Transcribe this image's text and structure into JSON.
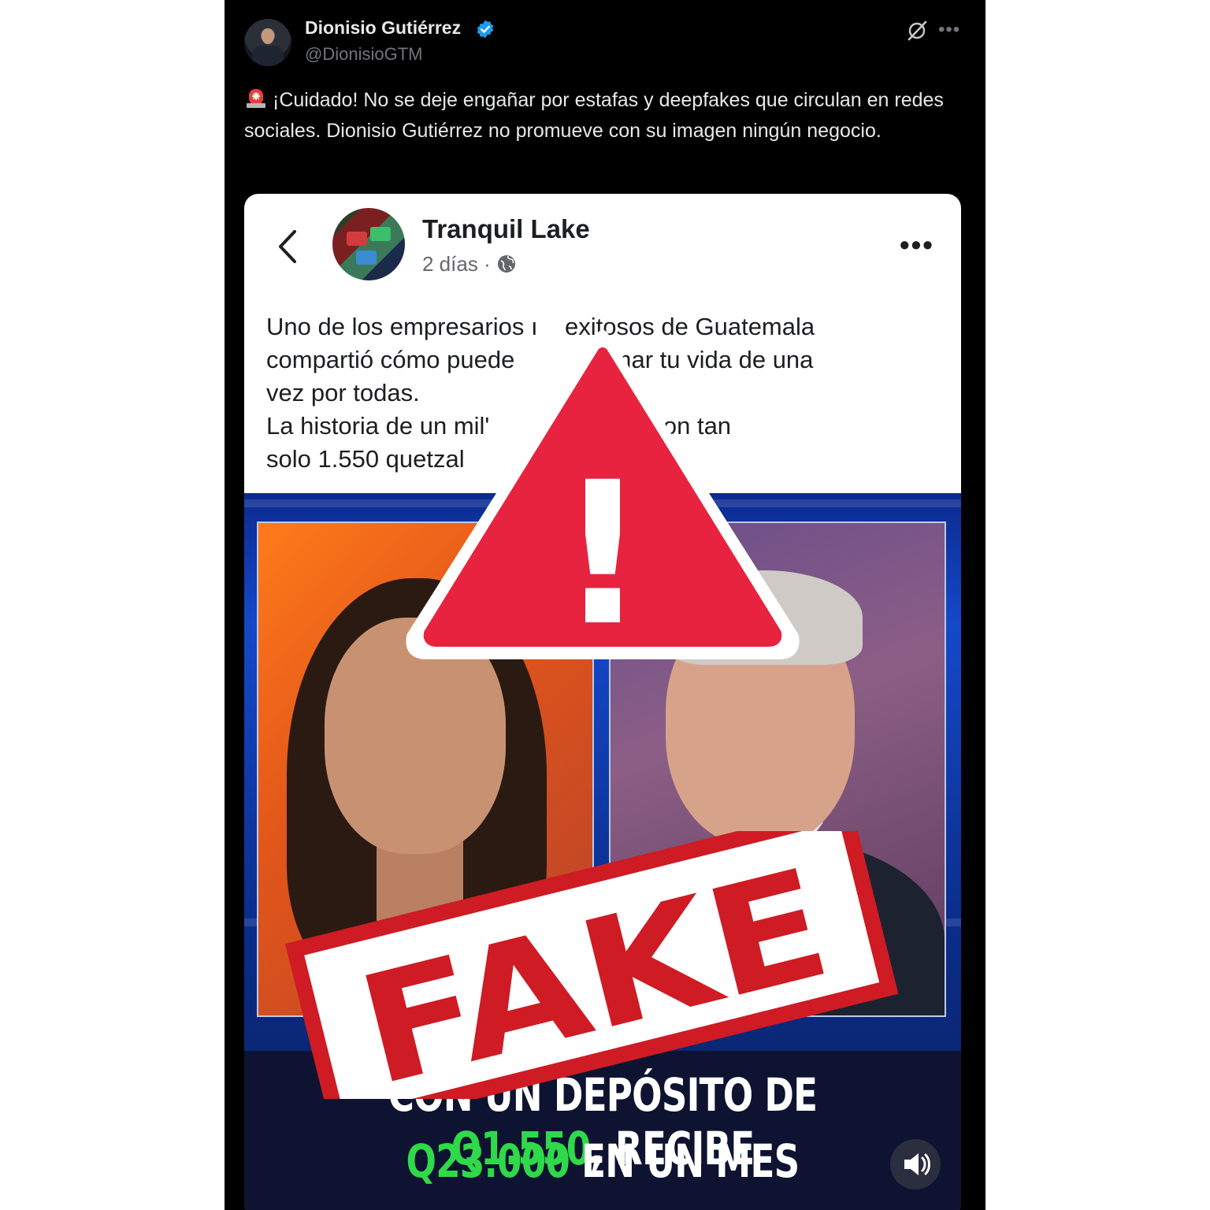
{
  "tweet": {
    "author_name": "Dionisio Gutiérrez",
    "author_handle": "@DionisioGTM",
    "text": "¡Cuidado! No se deje engañar por estafas y deepfakes que circulan en redes sociales. Dionisio Gutiérrez no promueve con su imagen ningún negocio.",
    "icons": [
      "verified-badge-icon",
      "grok-icon",
      "more-icon",
      "siren-emoji-icon"
    ],
    "colors": {
      "background": "#000000",
      "text": "#e7e9ea",
      "secondary": "#71767b",
      "verified": "#1d9bf0"
    }
  },
  "embedded_post": {
    "page_name": "Tranquil Lake",
    "time": "2 días",
    "separator": "·",
    "text_lines": [
      "Uno de los empresarios ı    exitosos de Guatemala",
      "compartió cómo puede           ormar tu vida de una",
      "vez por todas.",
      "La historia de un mil'            menzó con tan",
      "solo 1.550 quetzal"
    ],
    "icons": [
      "back-chevron-icon",
      "globe-icon",
      "more-horizontal-icon",
      "volume-icon"
    ],
    "banner": {
      "line1_a": "CON",
      "line1_b": " UN DEPÓSITO DE ",
      "line1_c": "Q1.550",
      "line1_d": ", RECIBE",
      "line2_a": "Q23.000",
      "line2_b": " EN UN MES"
    }
  },
  "overlay": {
    "stamp_text": "FAKE",
    "warning_symbol": "!",
    "colors": {
      "warning_red": "#e8233f",
      "stamp_red": "#cf1b24"
    }
  }
}
